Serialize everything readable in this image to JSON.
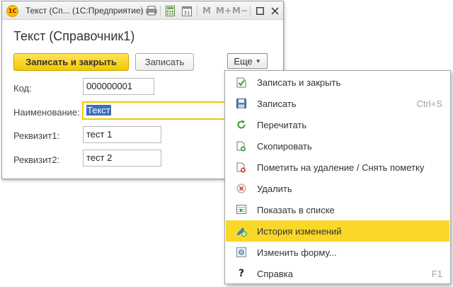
{
  "window": {
    "app_logo_text": "1С",
    "title": "Текст (Сп...  (1С:Предприятие)",
    "toolbar": {
      "m_label": "M",
      "mplus_label": "M+",
      "mminus_label": "M−",
      "print_icon": "print-icon",
      "calc_icon": "calculator-icon",
      "calendar_icon": "calendar-icon",
      "calendar_day": "31"
    }
  },
  "form": {
    "title": "Текст (Справочник1)",
    "buttons": {
      "save_close": "Записать и закрыть",
      "save": "Записать",
      "more": "Еще"
    },
    "fields": {
      "code": {
        "label": "Код:",
        "value": "000000001"
      },
      "name": {
        "label": "Наименование:",
        "value": "Текст"
      },
      "attr1": {
        "label": "Реквизит1:",
        "value": "тест 1"
      },
      "attr2": {
        "label": "Реквизит2:",
        "value": "тест 2"
      }
    }
  },
  "menu": {
    "items": [
      {
        "label": "Записать и закрыть",
        "shortcut": "",
        "icon": "save-close-icon"
      },
      {
        "label": "Записать",
        "shortcut": "Ctrl+S",
        "icon": "floppy-icon"
      },
      {
        "label": "Перечитать",
        "shortcut": "",
        "icon": "refresh-icon"
      },
      {
        "label": "Скопировать",
        "shortcut": "",
        "icon": "copy-icon"
      },
      {
        "label": "Пометить на удаление / Снять пометку",
        "shortcut": "",
        "icon": "mark-delete-icon"
      },
      {
        "label": "Удалить",
        "shortcut": "",
        "icon": "delete-icon"
      },
      {
        "label": "Показать в списке",
        "shortcut": "",
        "icon": "show-in-list-icon"
      },
      {
        "label": "История изменений",
        "shortcut": "",
        "icon": "history-icon"
      },
      {
        "label": "Изменить форму...",
        "shortcut": "",
        "icon": "edit-form-icon"
      },
      {
        "label": "Справка",
        "shortcut": "F1",
        "icon": "help-icon",
        "glyph": "?"
      }
    ],
    "highlighted_index": 7
  },
  "colors": {
    "accent_yellow": "#f3c800",
    "menu_highlight": "#fbd827",
    "selection_blue": "#3a6fb7"
  }
}
